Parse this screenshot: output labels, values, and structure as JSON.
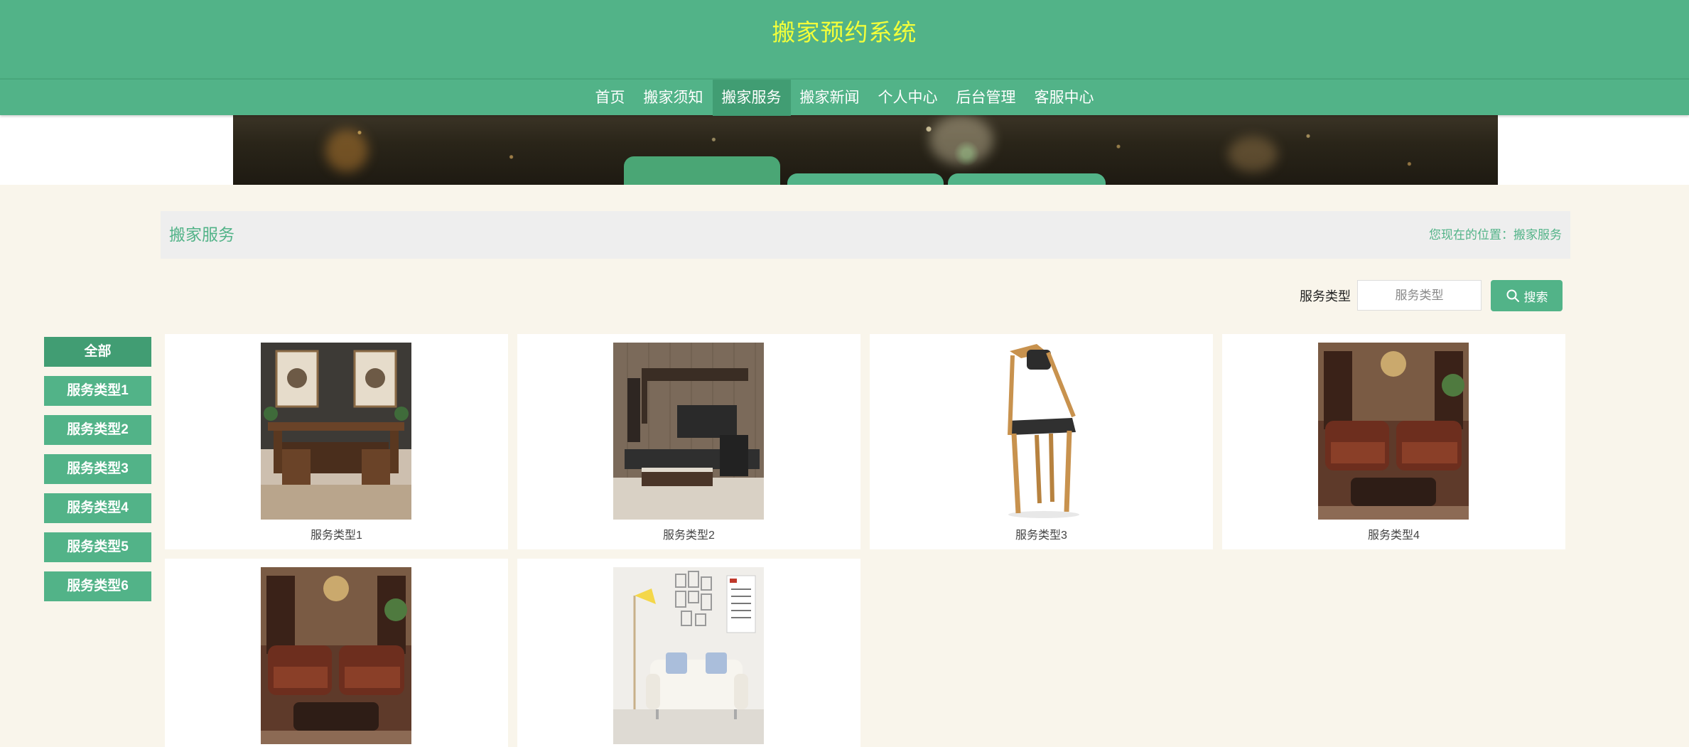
{
  "header": {
    "title": "搬家预约系统"
  },
  "nav": {
    "items": [
      {
        "label": "首页"
      },
      {
        "label": "搬家须知"
      },
      {
        "label": "搬家服务"
      },
      {
        "label": "搬家新闻"
      },
      {
        "label": "个人中心"
      },
      {
        "label": "后台管理"
      },
      {
        "label": "客服中心"
      }
    ],
    "active": "搬家服务"
  },
  "breadcrumb": {
    "title": "搬家服务",
    "location_text": "您现在的位置：搬家服务"
  },
  "search": {
    "label": "服务类型",
    "placeholder": "服务类型",
    "button_label": "搜索"
  },
  "sidebar": {
    "items": [
      {
        "label": "全部"
      },
      {
        "label": "服务类型1"
      },
      {
        "label": "服务类型2"
      },
      {
        "label": "服务类型3"
      },
      {
        "label": "服务类型4"
      },
      {
        "label": "服务类型5"
      },
      {
        "label": "服务类型6"
      }
    ],
    "active": "全部"
  },
  "products": [
    {
      "caption": "服务类型1",
      "image": "chinese-wooden-furniture"
    },
    {
      "caption": "服务类型2",
      "image": "tv-cabinet-living-room"
    },
    {
      "caption": "服务类型3",
      "image": "wooden-chair"
    },
    {
      "caption": "服务类型4",
      "image": "leather-sofa-set"
    },
    {
      "caption": "",
      "image": "leather-sofa-set"
    },
    {
      "caption": "",
      "image": "white-sofa-room"
    }
  ],
  "colors": {
    "primary": "#52b388",
    "primary_dark": "#419d73",
    "title_yellow": "#f3ff3a",
    "page_bg": "#f9f5eb"
  }
}
